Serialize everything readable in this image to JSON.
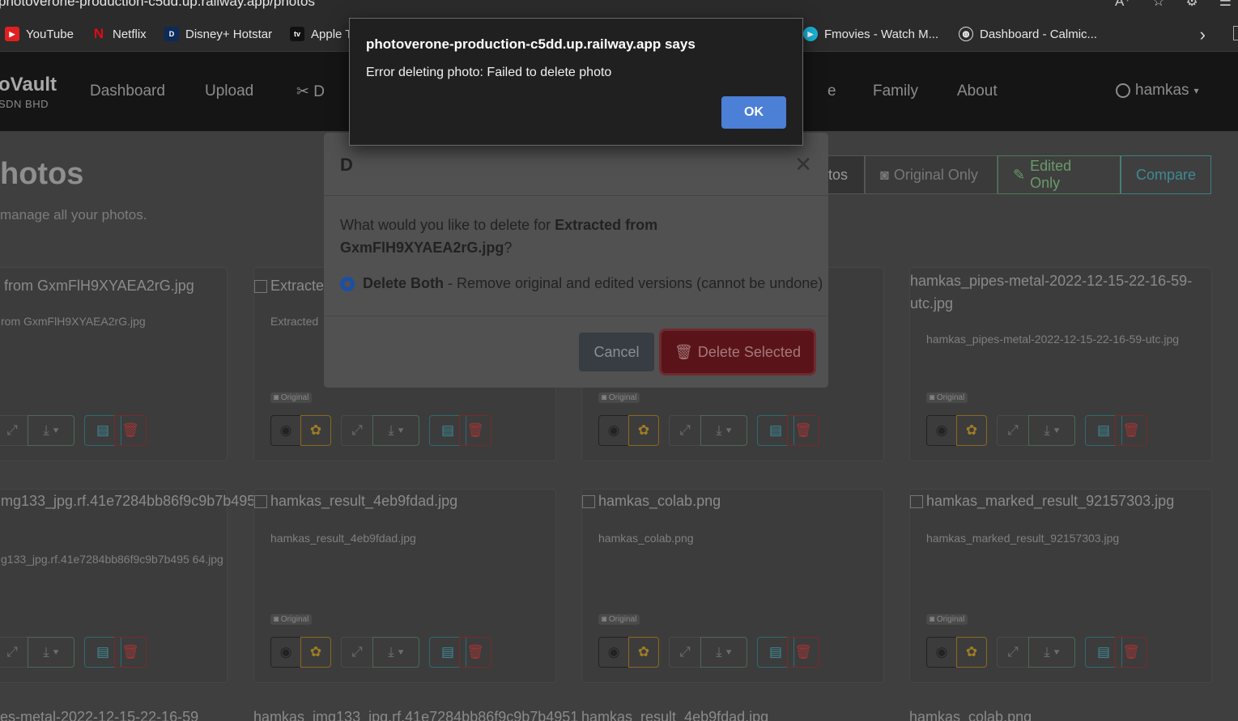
{
  "browser": {
    "url": "photoverone-production-c5dd.up.railway.app/photos",
    "bookmarks": [
      {
        "label": "YouTube"
      },
      {
        "label": "Netflix"
      },
      {
        "label": "Disney+ Hotstar"
      },
      {
        "label": "Apple T"
      },
      {
        "label": "Fmovies - Watch M..."
      },
      {
        "label": "Dashboard - Calmic..."
      }
    ]
  },
  "app": {
    "brand": "oVault",
    "brand_sub": "SDN BHD",
    "nav": [
      "Dashboard",
      "Upload",
      "D",
      "e",
      "Family",
      "About"
    ],
    "user": "hamkas",
    "page_title": "hotos",
    "page_subtitle": "manage all your photos.",
    "filters": [
      "tos",
      "Original Only",
      "Edited Only",
      "Compare"
    ]
  },
  "cards": [
    {
      "alt": "from GxmFlH9XYAEA2rG.jpg",
      "name": "rom GxmFlH9XYAEA2rG.jpg",
      "badge": ""
    },
    {
      "alt": "Extracted",
      "name": "Extracted",
      "badge": "Original"
    },
    {
      "alt": "",
      "name": "",
      "badge": "Original"
    },
    {
      "alt": "hamkas_pipes-metal-2022-12-15-22-16-59-utc.jpg",
      "name": "hamkas_pipes-metal-2022-12-15-22-16-59-utc.jpg",
      "badge": "Original"
    },
    {
      "alt": "mg133_jpg.rf.41e7284bb86f9c9b7b4951",
      "name": "g133_jpg.rf.41e7284bb86f9c9b7b495 64.jpg",
      "badge": ""
    },
    {
      "alt": "hamkas_result_4eb9fdad.jpg",
      "name": "hamkas_result_4eb9fdad.jpg",
      "badge": "Original"
    },
    {
      "alt": "hamkas_colab.png",
      "name": "hamkas_colab.png",
      "badge": "Original"
    },
    {
      "alt": "hamkas_marked_result_92157303.jpg",
      "name": "hamkas_marked_result_92157303.jpg",
      "badge": "Original"
    }
  ],
  "bottom_row": [
    "es-metal-2022-12-15-22-16-59",
    "hamkas_img133_jpg.rf.41e7284bb86f9c9b7b4951",
    "hamkas_result_4eb9fdad.jpg",
    "hamkas_colab.png"
  ],
  "modal": {
    "title": "D",
    "question_prefix": "What would you like to delete for ",
    "question_target": "Extracted from GxmFlH9XYAEA2rG.jpg",
    "question_suffix": "?",
    "option_label": "Delete Both",
    "option_desc": " - Remove original and edited versions (cannot be undone)",
    "cancel": "Cancel",
    "delete": "Delete Selected"
  },
  "alert": {
    "title": "photoverone-production-c5dd.up.railway.app says",
    "message": "Error deleting photo: Failed to delete photo",
    "ok": "OK"
  }
}
